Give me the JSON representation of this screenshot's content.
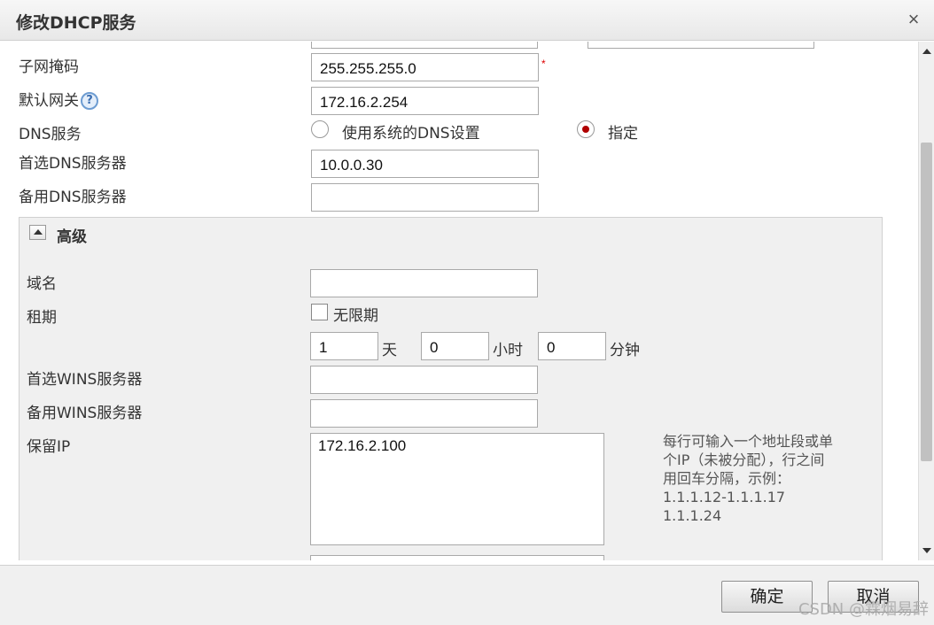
{
  "dialog": {
    "title": "修改DHCP服务",
    "close_label": "×"
  },
  "form": {
    "subnet_mask": {
      "label": "子网掩码",
      "value": "255.255.255.0",
      "required_mark": "*"
    },
    "gateway": {
      "label": "默认网关",
      "value": "172.16.2.254",
      "help": "?"
    },
    "dns_service": {
      "label": "DNS服务",
      "option_system": "使用系统的DNS设置",
      "option_custom": "指定",
      "selected": "指定"
    },
    "primary_dns": {
      "label": "首选DNS服务器",
      "value": "10.0.0.30"
    },
    "secondary_dns": {
      "label": "备用DNS服务器",
      "value": ""
    }
  },
  "advanced": {
    "title": "高级",
    "domain": {
      "label": "域名",
      "value": ""
    },
    "lease": {
      "label": "租期",
      "unlimited_label": "无限期",
      "unlimited_checked": false,
      "days_value": "1",
      "days_unit": "天",
      "hours_value": "0",
      "hours_unit": "小时",
      "minutes_value": "0",
      "minutes_unit": "分钟"
    },
    "primary_wins": {
      "label": "首选WINS服务器",
      "value": ""
    },
    "secondary_wins": {
      "label": "备用WINS服务器",
      "value": ""
    },
    "reserved_ip": {
      "label": "保留IP",
      "value": "172.16.2.100",
      "hint_lines": [
        "每行可输入一个地址段或单",
        "个IP（未被分配），行之间",
        "用回车分隔，示例：",
        "1.1.1.12-1.1.1.17",
        "1.1.1.24"
      ]
    }
  },
  "footer": {
    "ok_label": "确定",
    "cancel_label": "取消"
  },
  "watermark": "CSDN @霖烟易辞"
}
